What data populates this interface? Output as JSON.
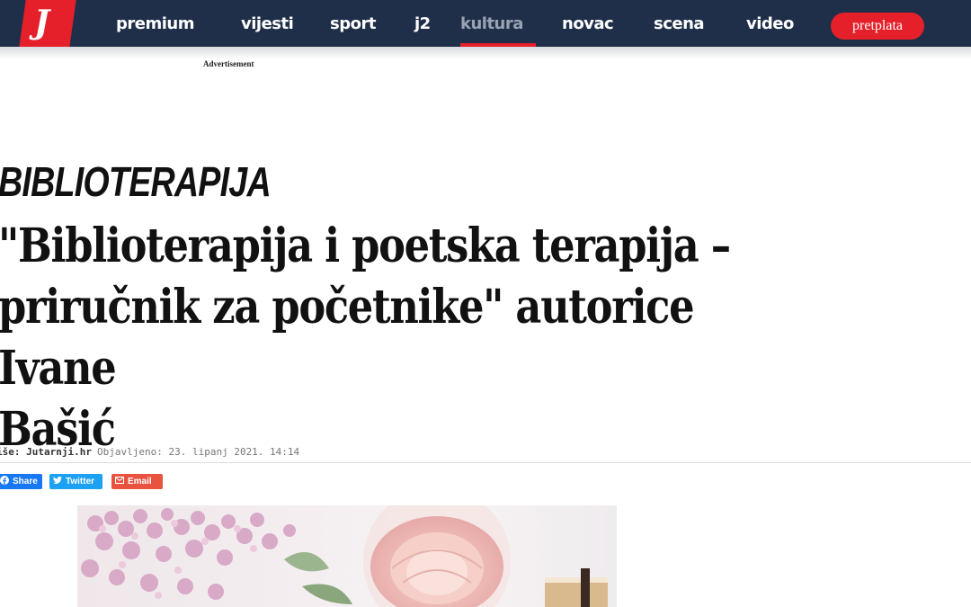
{
  "header": {
    "logo_letter": "J",
    "nav": [
      "premium",
      "vijesti",
      "sport",
      "j2",
      "kultura",
      "novac",
      "scena",
      "video"
    ],
    "active_nav": "kultura",
    "subscribe_label": "pretplata",
    "colors": {
      "bar": "#1f2f4a",
      "accent": "#e5202a"
    }
  },
  "ad": {
    "label": "Advertisement"
  },
  "article": {
    "kicker": "BIBLIOTERAPIJA",
    "title_lines": [
      "\"Biblioterapija i poetska terapija –",
      "priručnik za početnike\" autorice Ivane",
      "Bašić"
    ],
    "byline": "iše: Jutarnji.hr",
    "published": "Objavljeno: 23. lipanj 2021. 14:14"
  },
  "share": {
    "facebook_label": "Share",
    "twitter_label": "Twitter",
    "email_label": "Email",
    "colors": {
      "facebook": "#1877f2",
      "twitter": "#1da1f2",
      "email": "#e8523f"
    }
  },
  "hero": {
    "icon": "flowers-photo"
  }
}
